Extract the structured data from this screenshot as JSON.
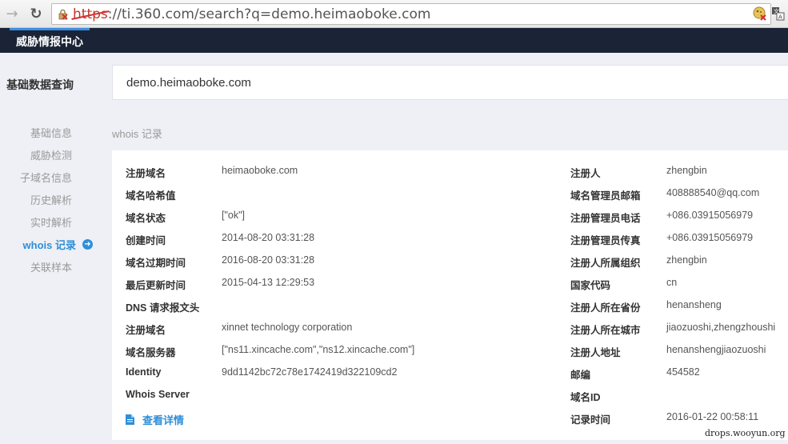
{
  "browser": {
    "url_scheme": "https",
    "url_rest": "://ti.360.com/search?q=demo.heimaoboke.com",
    "back_icon": "arrow-left",
    "reload_icon": "reload"
  },
  "header": {
    "title": "威胁情报中心"
  },
  "sidebar": {
    "title": "基础数据查询",
    "items": [
      {
        "label": "基础信息"
      },
      {
        "label": "威胁检测"
      },
      {
        "label": "子域名信息"
      },
      {
        "label": "历史解析"
      },
      {
        "label": "实时解析"
      },
      {
        "label": "whois 记录"
      },
      {
        "label": "关联样本"
      }
    ],
    "active_item": "whois 记录"
  },
  "search": {
    "value": "demo.heimaoboke.com"
  },
  "section": {
    "title": "whois 记录"
  },
  "whois": {
    "left": [
      {
        "label": "注册域名",
        "value": "heimaoboke.com"
      },
      {
        "label": "域名哈希值",
        "value": ""
      },
      {
        "label": "域名状态",
        "value": "[\"ok\"]"
      },
      {
        "label": "创建时间",
        "value": "2014-08-20 03:31:28"
      },
      {
        "label": "域名过期时间",
        "value": "2016-08-20 03:31:28"
      },
      {
        "label": "最后更新时间",
        "value": "2015-04-13 12:29:53"
      },
      {
        "label": "DNS 请求报文头",
        "value": ""
      },
      {
        "label": "注册域名",
        "value": "xinnet technology corporation"
      },
      {
        "label": "域名服务器",
        "value": "[\"ns11.xincache.com\",\"ns12.xincache.com\"]"
      },
      {
        "label": "Identity",
        "value": "9dd1142bc72c78e1742419d322109cd2"
      },
      {
        "label": "Whois Server",
        "value": ""
      }
    ],
    "right": [
      {
        "label": "注册人",
        "value": "zhengbin"
      },
      {
        "label": "域名管理员邮箱",
        "value": "408888540@qq.com"
      },
      {
        "label": "注册管理员电话",
        "value": "+086.03915056979"
      },
      {
        "label": "注册管理员传真",
        "value": "+086.03915056979"
      },
      {
        "label": "注册人所属组织",
        "value": "zhengbin"
      },
      {
        "label": "国家代码",
        "value": "cn"
      },
      {
        "label": "注册人所在省份",
        "value": "henansheng"
      },
      {
        "label": "注册人所在城市",
        "value": "jiaozuoshi,zhengzhoushi"
      },
      {
        "label": "注册人地址",
        "value": "henanshengjiaozuoshi"
      },
      {
        "label": "邮编",
        "value": "454582"
      },
      {
        "label": "域名ID",
        "value": ""
      },
      {
        "label": "记录时间",
        "value": "2016-01-22 00:58:11"
      }
    ],
    "detail_link": "查看详情"
  },
  "watermark": "drops.wooyun.org",
  "colors": {
    "accent": "#2f8fd8",
    "header_bg": "#1b2436",
    "page_bg": "#eef0f5"
  }
}
